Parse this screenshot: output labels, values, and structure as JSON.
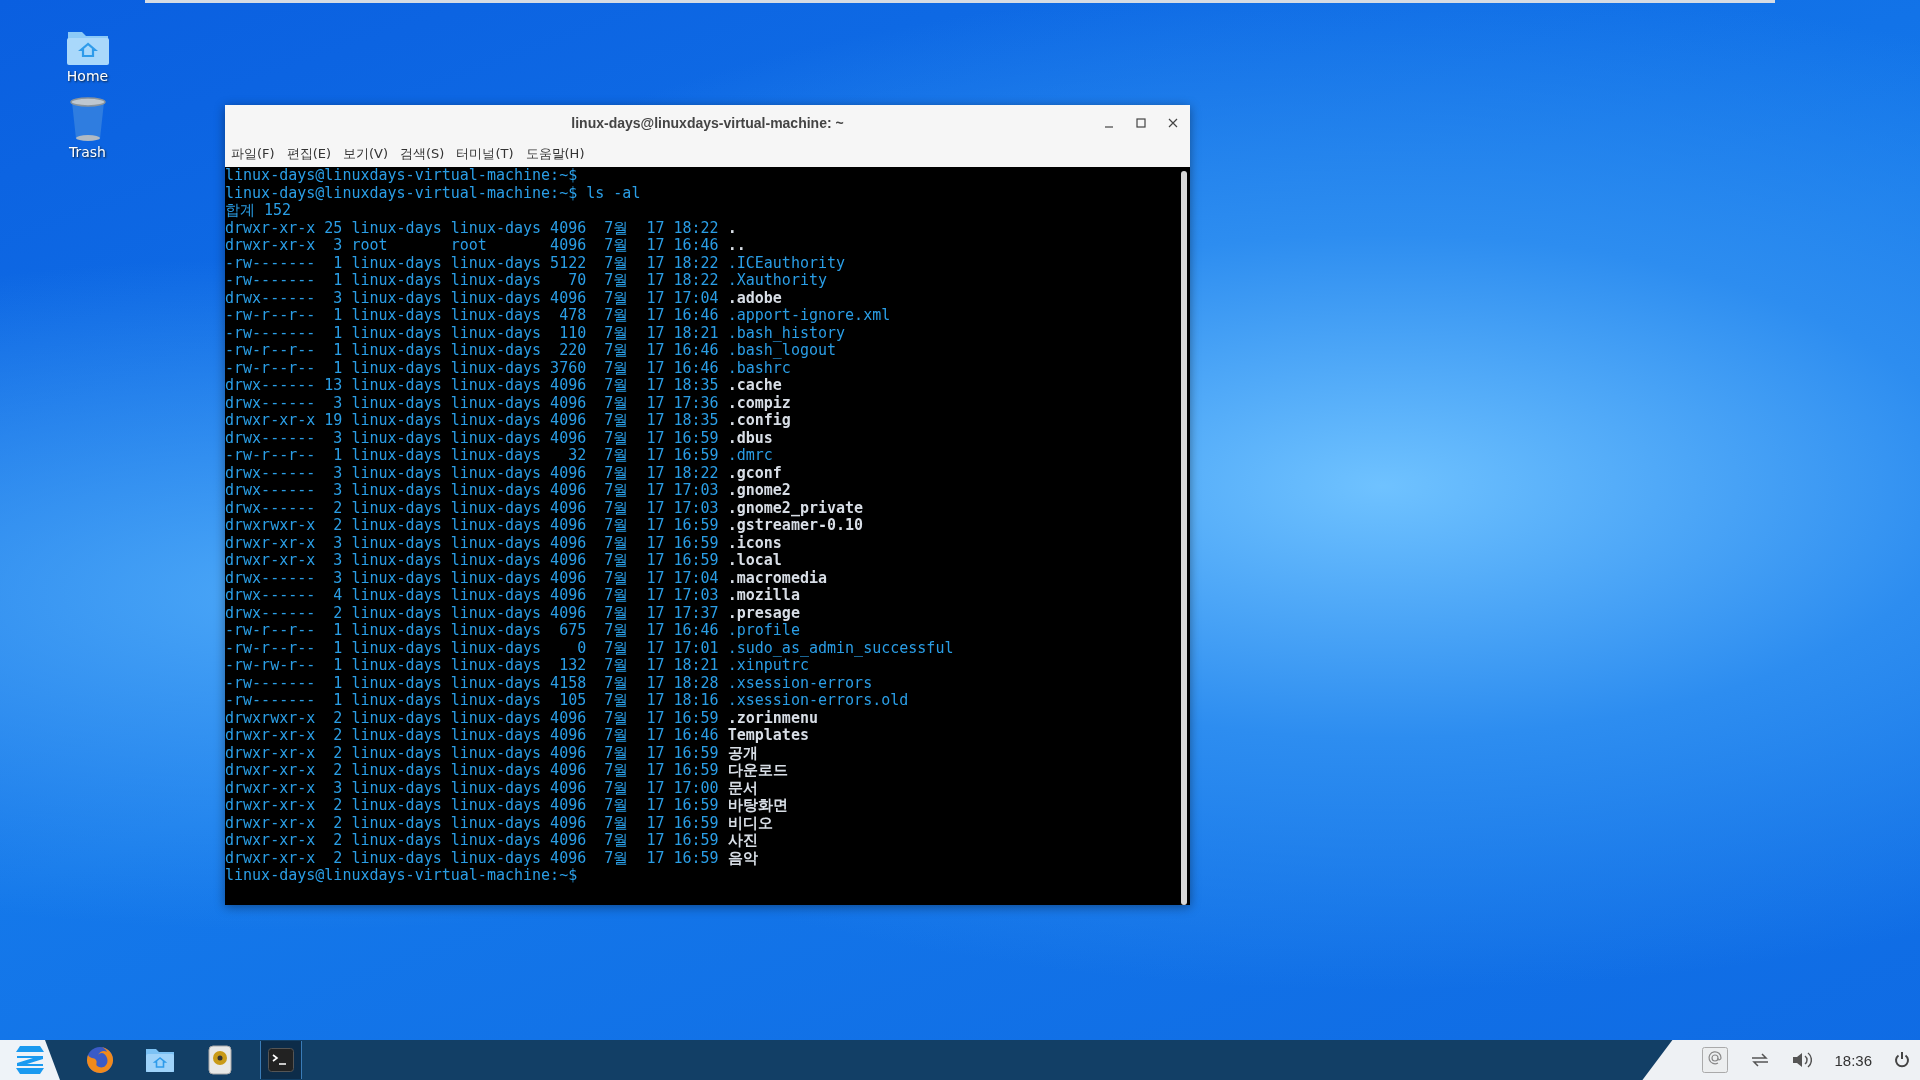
{
  "desktop_icons": [
    {
      "kind": "home",
      "label": "Home"
    },
    {
      "kind": "trash",
      "label": "Trash"
    }
  ],
  "terminal": {
    "title": "linux-days@linuxdays-virtual-machine: ~",
    "menu": [
      "파일(F)",
      "편집(E)",
      "보기(V)",
      "검색(S)",
      "터미널(T)",
      "도움말(H)"
    ],
    "lines": [
      {
        "kind": "text",
        "text": "linux-days@linuxdays-virtual-machine:~$"
      },
      {
        "kind": "text",
        "text": "linux-days@linuxdays-virtual-machine:~$ ls -al"
      },
      {
        "kind": "text",
        "text": "합계 152"
      },
      {
        "kind": "dir",
        "text": "drwxr-xr-x 25 linux-days linux-days 4096  7월  17 18:22 ",
        "name": "."
      },
      {
        "kind": "dir",
        "text": "drwxr-xr-x  3 root       root       4096  7월  17 16:46 ",
        "name": ".."
      },
      {
        "kind": "file",
        "text": "-rw-------  1 linux-days linux-days 5122  7월  17 18:22 ",
        "name": ".ICEauthority"
      },
      {
        "kind": "file",
        "text": "-rw-------  1 linux-days linux-days   70  7월  17 18:22 ",
        "name": ".Xauthority"
      },
      {
        "kind": "dir",
        "text": "drwx------  3 linux-days linux-days 4096  7월  17 17:04 ",
        "name": ".adobe"
      },
      {
        "kind": "file",
        "text": "-rw-r--r--  1 linux-days linux-days  478  7월  17 16:46 ",
        "name": ".apport-ignore.xml"
      },
      {
        "kind": "file",
        "text": "-rw-------  1 linux-days linux-days  110  7월  17 18:21 ",
        "name": ".bash_history"
      },
      {
        "kind": "file",
        "text": "-rw-r--r--  1 linux-days linux-days  220  7월  17 16:46 ",
        "name": ".bash_logout"
      },
      {
        "kind": "file",
        "text": "-rw-r--r--  1 linux-days linux-days 3760  7월  17 16:46 ",
        "name": ".bashrc"
      },
      {
        "kind": "dir",
        "text": "drwx------ 13 linux-days linux-days 4096  7월  17 18:35 ",
        "name": ".cache"
      },
      {
        "kind": "dir",
        "text": "drwx------  3 linux-days linux-days 4096  7월  17 17:36 ",
        "name": ".compiz"
      },
      {
        "kind": "dir",
        "text": "drwxr-xr-x 19 linux-days linux-days 4096  7월  17 18:35 ",
        "name": ".config"
      },
      {
        "kind": "dir",
        "text": "drwx------  3 linux-days linux-days 4096  7월  17 16:59 ",
        "name": ".dbus"
      },
      {
        "kind": "file",
        "text": "-rw-r--r--  1 linux-days linux-days   32  7월  17 16:59 ",
        "name": ".dmrc"
      },
      {
        "kind": "dir",
        "text": "drwx------  3 linux-days linux-days 4096  7월  17 18:22 ",
        "name": ".gconf"
      },
      {
        "kind": "dir",
        "text": "drwx------  3 linux-days linux-days 4096  7월  17 17:03 ",
        "name": ".gnome2"
      },
      {
        "kind": "dir",
        "text": "drwx------  2 linux-days linux-days 4096  7월  17 17:03 ",
        "name": ".gnome2_private"
      },
      {
        "kind": "dir",
        "text": "drwxrwxr-x  2 linux-days linux-days 4096  7월  17 16:59 ",
        "name": ".gstreamer-0.10"
      },
      {
        "kind": "dir",
        "text": "drwxr-xr-x  3 linux-days linux-days 4096  7월  17 16:59 ",
        "name": ".icons"
      },
      {
        "kind": "dir",
        "text": "drwxr-xr-x  3 linux-days linux-days 4096  7월  17 16:59 ",
        "name": ".local"
      },
      {
        "kind": "dir",
        "text": "drwx------  3 linux-days linux-days 4096  7월  17 17:04 ",
        "name": ".macromedia"
      },
      {
        "kind": "dir",
        "text": "drwx------  4 linux-days linux-days 4096  7월  17 17:03 ",
        "name": ".mozilla"
      },
      {
        "kind": "dir",
        "text": "drwx------  2 linux-days linux-days 4096  7월  17 17:37 ",
        "name": ".presage"
      },
      {
        "kind": "file",
        "text": "-rw-r--r--  1 linux-days linux-days  675  7월  17 16:46 ",
        "name": ".profile"
      },
      {
        "kind": "file",
        "text": "-rw-r--r--  1 linux-days linux-days    0  7월  17 17:01 ",
        "name": ".sudo_as_admin_successful"
      },
      {
        "kind": "file",
        "text": "-rw-rw-r--  1 linux-days linux-days  132  7월  17 18:21 ",
        "name": ".xinputrc"
      },
      {
        "kind": "file",
        "text": "-rw-------  1 linux-days linux-days 4158  7월  17 18:28 ",
        "name": ".xsession-errors"
      },
      {
        "kind": "file",
        "text": "-rw-------  1 linux-days linux-days  105  7월  17 18:16 ",
        "name": ".xsession-errors.old"
      },
      {
        "kind": "dir",
        "text": "drwxrwxr-x  2 linux-days linux-days 4096  7월  17 16:59 ",
        "name": ".zorinmenu"
      },
      {
        "kind": "dir",
        "text": "drwxr-xr-x  2 linux-days linux-days 4096  7월  17 16:46 ",
        "name": "Templates"
      },
      {
        "kind": "dir",
        "text": "drwxr-xr-x  2 linux-days linux-days 4096  7월  17 16:59 ",
        "name": "공개"
      },
      {
        "kind": "dir",
        "text": "drwxr-xr-x  2 linux-days linux-days 4096  7월  17 16:59 ",
        "name": "다운로드"
      },
      {
        "kind": "dir",
        "text": "drwxr-xr-x  3 linux-days linux-days 4096  7월  17 17:00 ",
        "name": "문서"
      },
      {
        "kind": "dir",
        "text": "drwxr-xr-x  2 linux-days linux-days 4096  7월  17 16:59 ",
        "name": "바탕화면"
      },
      {
        "kind": "dir",
        "text": "drwxr-xr-x  2 linux-days linux-days 4096  7월  17 16:59 ",
        "name": "비디오"
      },
      {
        "kind": "dir",
        "text": "drwxr-xr-x  2 linux-days linux-days 4096  7월  17 16:59 ",
        "name": "사진"
      },
      {
        "kind": "dir",
        "text": "drwxr-xr-x  2 linux-days linux-days 4096  7월  17 16:59 ",
        "name": "음악"
      },
      {
        "kind": "text",
        "text": "linux-days@linuxdays-virtual-machine:~$"
      }
    ]
  },
  "taskbar": {
    "apps": [
      {
        "kind": "browser",
        "active": false
      },
      {
        "kind": "files",
        "active": false
      },
      {
        "kind": "speaker",
        "active": false
      },
      {
        "kind": "terminal",
        "active": true
      }
    ],
    "clock": "18:36"
  }
}
